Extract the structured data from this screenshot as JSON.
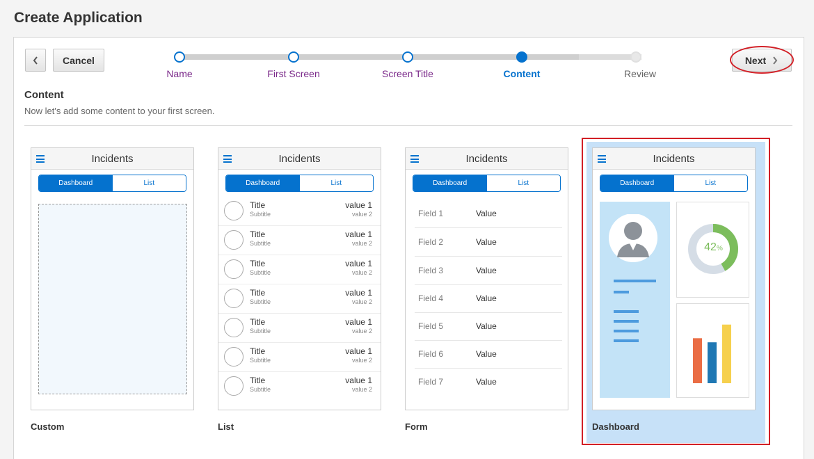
{
  "page": {
    "title": "Create Application"
  },
  "toolbar": {
    "back_icon": "chevron-left-icon",
    "cancel_label": "Cancel",
    "next_label": "Next",
    "next_icon": "chevron-right-icon"
  },
  "wizard": {
    "steps": [
      {
        "label": "Name",
        "state": "completed"
      },
      {
        "label": "First Screen",
        "state": "completed"
      },
      {
        "label": "Screen Title",
        "state": "completed"
      },
      {
        "label": "Content",
        "state": "current"
      },
      {
        "label": "Review",
        "state": "future"
      }
    ]
  },
  "content": {
    "title": "Content",
    "description": "Now let's add some content to your first screen."
  },
  "templates": [
    {
      "label": "Custom",
      "header": "Incidents",
      "seg_on": "Dashboard",
      "seg_off": "List",
      "selected": false
    },
    {
      "label": "List",
      "header": "Incidents",
      "seg_on": "Dashboard",
      "seg_off": "List",
      "selected": false
    },
    {
      "label": "Form",
      "header": "Incidents",
      "seg_on": "Dashboard",
      "seg_off": "List",
      "selected": false
    },
    {
      "label": "Dashboard",
      "header": "Incidents",
      "seg_on": "Dashboard",
      "seg_off": "List",
      "selected": true
    }
  ],
  "list_items": [
    {
      "title": "Title",
      "subtitle": "Subtitle",
      "value1": "value 1",
      "value2": "value 2"
    },
    {
      "title": "Title",
      "subtitle": "Subtitle",
      "value1": "value 1",
      "value2": "value 2"
    },
    {
      "title": "Title",
      "subtitle": "Subtitle",
      "value1": "value 1",
      "value2": "value 2"
    },
    {
      "title": "Title",
      "subtitle": "Subtitle",
      "value1": "value 1",
      "value2": "value 2"
    },
    {
      "title": "Title",
      "subtitle": "Subtitle",
      "value1": "value 1",
      "value2": "value 2"
    },
    {
      "title": "Title",
      "subtitle": "Subtitle",
      "value1": "value 1",
      "value2": "value 2"
    },
    {
      "title": "Title",
      "subtitle": "Subtitle",
      "value1": "value 1",
      "value2": "value 2"
    }
  ],
  "form_rows": [
    {
      "field": "Field 1",
      "value": "Value"
    },
    {
      "field": "Field 2",
      "value": "Value"
    },
    {
      "field": "Field 3",
      "value": "Value"
    },
    {
      "field": "Field 4",
      "value": "Value"
    },
    {
      "field": "Field 5",
      "value": "Value"
    },
    {
      "field": "Field 6",
      "value": "Value"
    },
    {
      "field": "Field 7",
      "value": "Value"
    }
  ],
  "dashboard": {
    "donut_value": "42",
    "donut_unit": "%",
    "donut_fraction": 0.42,
    "bar_colors": [
      "#ea6d45",
      "#1f78b4",
      "#f6d04d"
    ],
    "bar_values": [
      0.66,
      0.6,
      0.86
    ]
  },
  "colors": {
    "accent": "#0572ce",
    "callout": "#d21f26",
    "selected_bg": "#c7e1f8",
    "donut": "#7cbd5c"
  }
}
